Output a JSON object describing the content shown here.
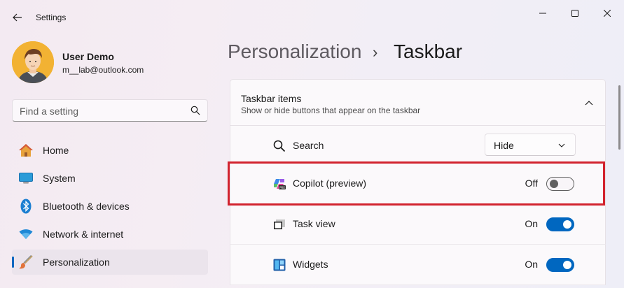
{
  "window": {
    "title": "Settings"
  },
  "user": {
    "name": "User Demo",
    "email": "m__lab@outlook.com"
  },
  "search": {
    "placeholder": "Find a setting",
    "value": ""
  },
  "sidebar": {
    "items": [
      {
        "label": "Home",
        "icon": "home-icon",
        "active": false
      },
      {
        "label": "System",
        "icon": "system-icon",
        "active": false
      },
      {
        "label": "Bluetooth & devices",
        "icon": "bluetooth-icon",
        "active": false
      },
      {
        "label": "Network & internet",
        "icon": "wifi-icon",
        "active": false
      },
      {
        "label": "Personalization",
        "icon": "brush-icon",
        "active": true
      }
    ]
  },
  "header": {
    "parent": "Personalization",
    "separator": "›",
    "current": "Taskbar"
  },
  "section": {
    "title": "Taskbar items",
    "subtitle": "Show or hide buttons that appear on the taskbar"
  },
  "items": [
    {
      "label": "Search",
      "icon": "search-icon",
      "control": "dropdown",
      "value": "Hide"
    },
    {
      "label": "Copilot (preview)",
      "icon": "copilot-icon",
      "control": "toggle",
      "state": "Off",
      "highlighted": true
    },
    {
      "label": "Task view",
      "icon": "task-view-icon",
      "control": "toggle",
      "state": "On"
    },
    {
      "label": "Widgets",
      "icon": "widgets-icon",
      "control": "toggle",
      "state": "On"
    }
  ],
  "colors": {
    "accent": "#0067c0",
    "highlight": "#d2232e"
  }
}
